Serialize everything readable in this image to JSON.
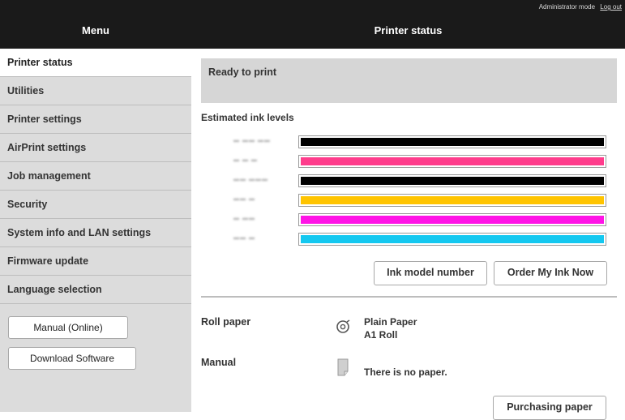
{
  "header": {
    "mode_text": "Administrator mode",
    "logout_label": "Log out",
    "menu_title": "Menu",
    "page_title": "Printer status"
  },
  "sidebar": {
    "items": [
      {
        "label": "Printer status",
        "active": true
      },
      {
        "label": "Utilities"
      },
      {
        "label": "Printer settings"
      },
      {
        "label": "AirPrint settings"
      },
      {
        "label": "Job management"
      },
      {
        "label": "Security"
      },
      {
        "label": "System info and LAN settings"
      },
      {
        "label": "Firmware update"
      },
      {
        "label": "Language selection"
      }
    ],
    "manual_button": "Manual (Online)",
    "download_button": "Download Software"
  },
  "main": {
    "status_text": "Ready to print",
    "ink_title": "Estimated ink levels",
    "ink_levels": [
      {
        "color": "#000000",
        "level": 1.0
      },
      {
        "color": "#ff3c8c",
        "level": 1.0
      },
      {
        "color": "#000000",
        "level": 1.0
      },
      {
        "color": "#ffc400",
        "level": 1.0
      },
      {
        "color": "#ff14e6",
        "level": 1.0
      },
      {
        "color": "#14c8f0",
        "level": 1.0
      }
    ],
    "ink_model_button": "Ink model number",
    "order_button": "Order My Ink Now",
    "roll_paper_label": "Roll paper",
    "roll_paper_type": "Plain Paper",
    "roll_paper_size": "A1 Roll",
    "manual_label": "Manual",
    "manual_status": "There is no paper.",
    "purchasing_button": "Purchasing paper"
  }
}
